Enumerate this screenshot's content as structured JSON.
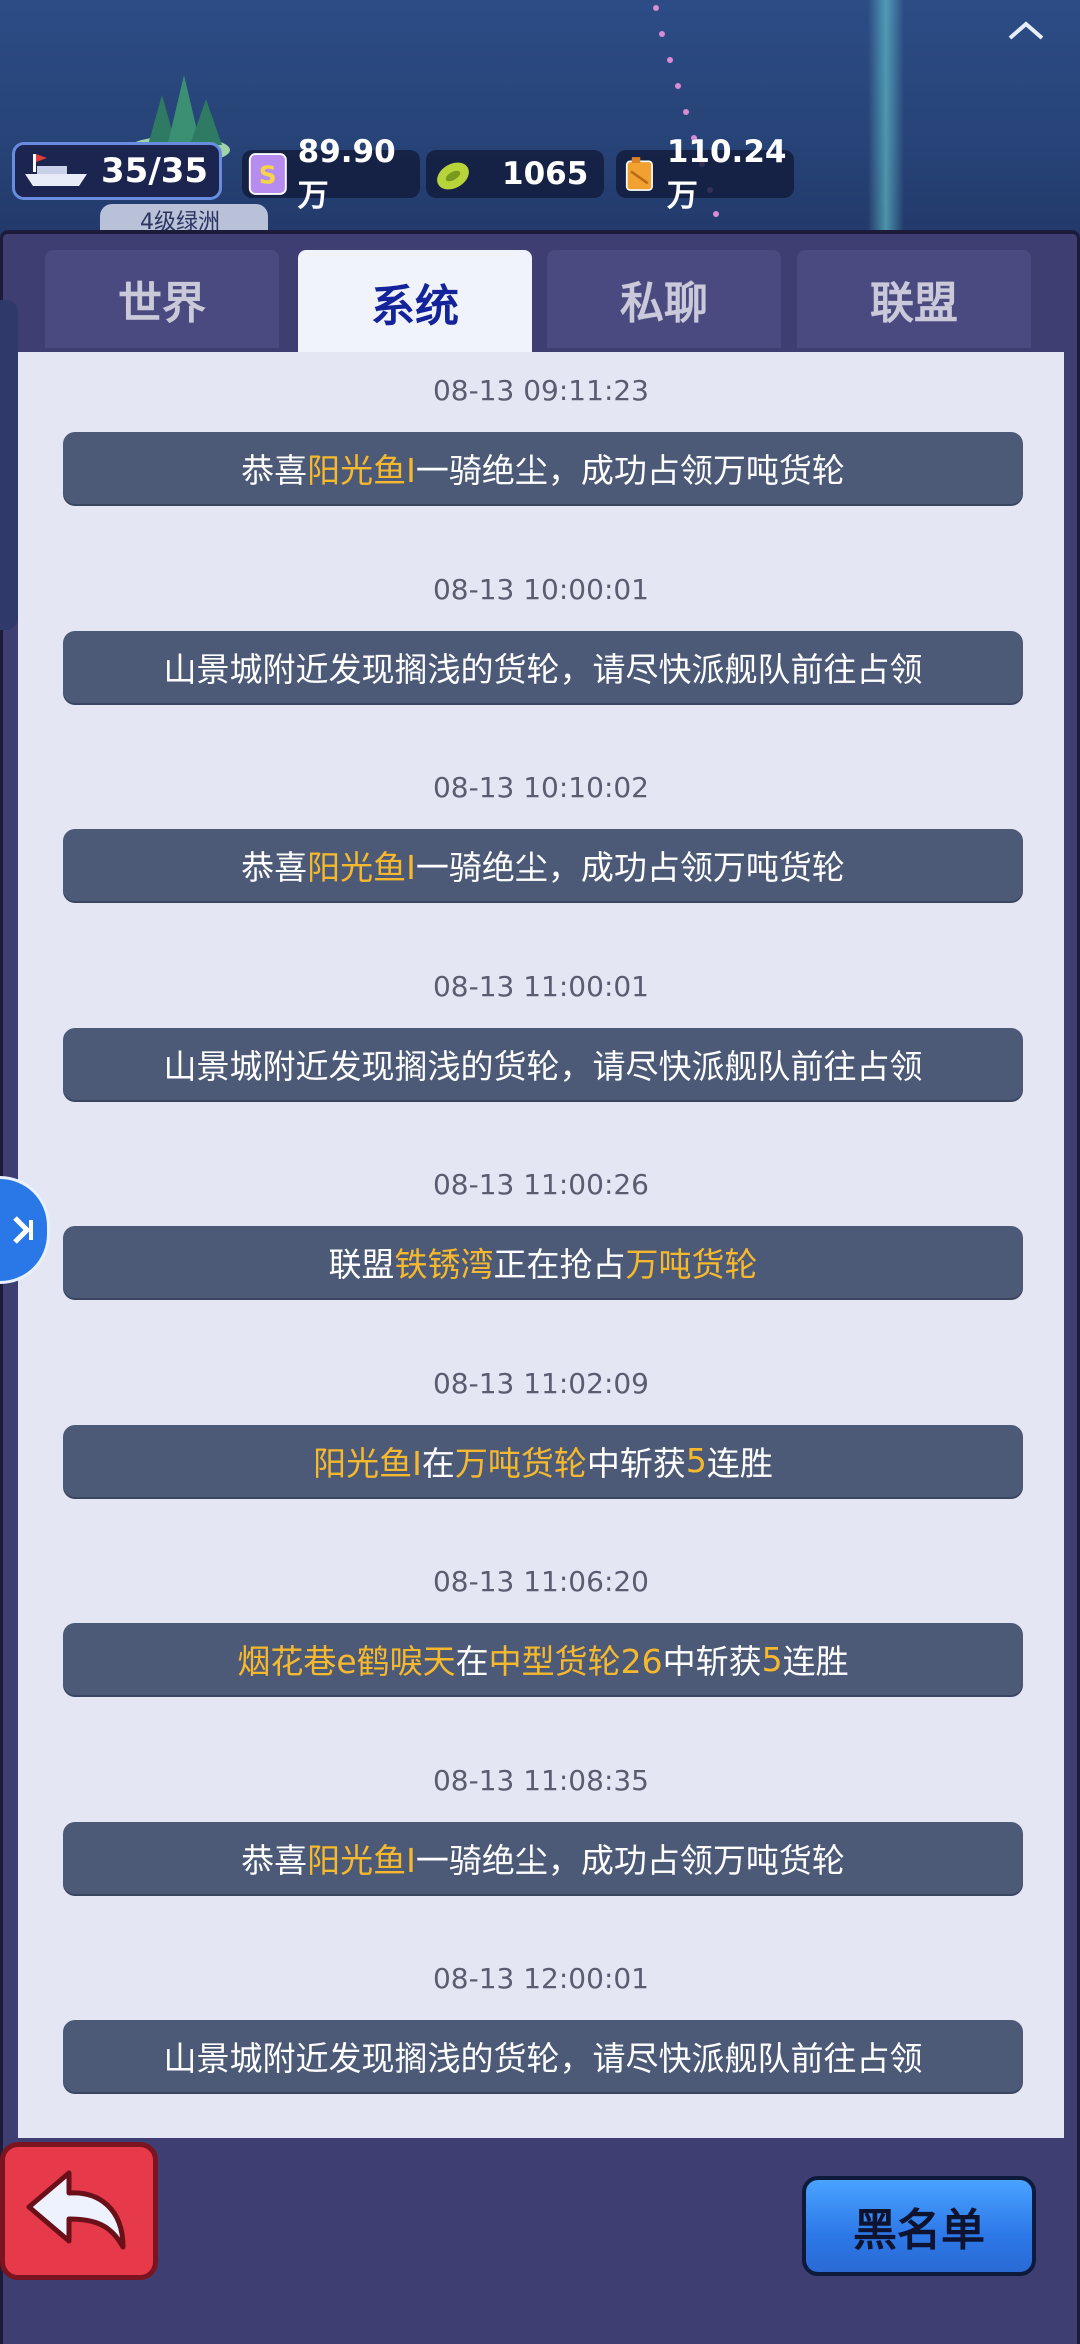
{
  "top_bar": {
    "fleet": "35/35",
    "coins": "89.90万",
    "food": "1065",
    "oil": "110.24万",
    "island_label": "4级绿洲"
  },
  "tabs": [
    {
      "label": "世界",
      "active": false
    },
    {
      "label": "系统",
      "active": true
    },
    {
      "label": "私聊",
      "active": false
    },
    {
      "label": "联盟",
      "active": false
    }
  ],
  "messages": [
    {
      "time": "08-13 09:11:23",
      "parts": [
        {
          "t": "恭喜",
          "h": false
        },
        {
          "t": "阳光鱼I",
          "h": true
        },
        {
          "t": "一骑绝尘，成功占领万吨货轮",
          "h": false
        }
      ]
    },
    {
      "time": "08-13 10:00:01",
      "parts": [
        {
          "t": "山景城附近发现搁浅的货轮，请尽快派舰队前往占领",
          "h": false
        }
      ]
    },
    {
      "time": "08-13 10:10:02",
      "parts": [
        {
          "t": "恭喜",
          "h": false
        },
        {
          "t": "阳光鱼I",
          "h": true
        },
        {
          "t": "一骑绝尘，成功占领万吨货轮",
          "h": false
        }
      ]
    },
    {
      "time": "08-13 11:00:01",
      "parts": [
        {
          "t": "山景城附近发现搁浅的货轮，请尽快派舰队前往占领",
          "h": false
        }
      ]
    },
    {
      "time": "08-13 11:00:26",
      "parts": [
        {
          "t": "联盟",
          "h": false
        },
        {
          "t": "铁锈湾",
          "h": true
        },
        {
          "t": "正在抢占",
          "h": false
        },
        {
          "t": "万吨货轮",
          "h": true
        }
      ]
    },
    {
      "time": "08-13 11:02:09",
      "parts": [
        {
          "t": "阳光鱼I",
          "h": true
        },
        {
          "t": "在",
          "h": false
        },
        {
          "t": "万吨货轮",
          "h": true
        },
        {
          "t": "中斩获",
          "h": false
        },
        {
          "t": "5",
          "h": true
        },
        {
          "t": "连胜",
          "h": false
        }
      ]
    },
    {
      "time": "08-13 11:06:20",
      "parts": [
        {
          "t": "烟花巷e鹤唳天",
          "h": true
        },
        {
          "t": "在",
          "h": false
        },
        {
          "t": "中型货轮26",
          "h": true
        },
        {
          "t": "中斩获",
          "h": false
        },
        {
          "t": "5",
          "h": true
        },
        {
          "t": "连胜",
          "h": false
        }
      ]
    },
    {
      "time": "08-13 11:08:35",
      "parts": [
        {
          "t": "恭喜",
          "h": false
        },
        {
          "t": "阳光鱼I",
          "h": true
        },
        {
          "t": "一骑绝尘，成功占领万吨货轮",
          "h": false
        }
      ]
    },
    {
      "time": "08-13 12:00:01",
      "parts": [
        {
          "t": "山景城附近发现搁浅的货轮，请尽快派舰队前往占领",
          "h": false
        }
      ]
    }
  ],
  "buttons": {
    "blacklist": "黑名单"
  },
  "colors": {
    "highlight": "#f6b92e",
    "message_bg": "#4c5a77",
    "active_tab_text": "#14239a",
    "blacklist_button": "#2d78e8",
    "back_button": "#e63949"
  },
  "icons": [
    "fleet-ship-icon",
    "coin-icon",
    "food-icon",
    "oil-icon",
    "back-arrow-icon",
    "collapse-chevron-icon",
    "side-float-icon"
  ]
}
